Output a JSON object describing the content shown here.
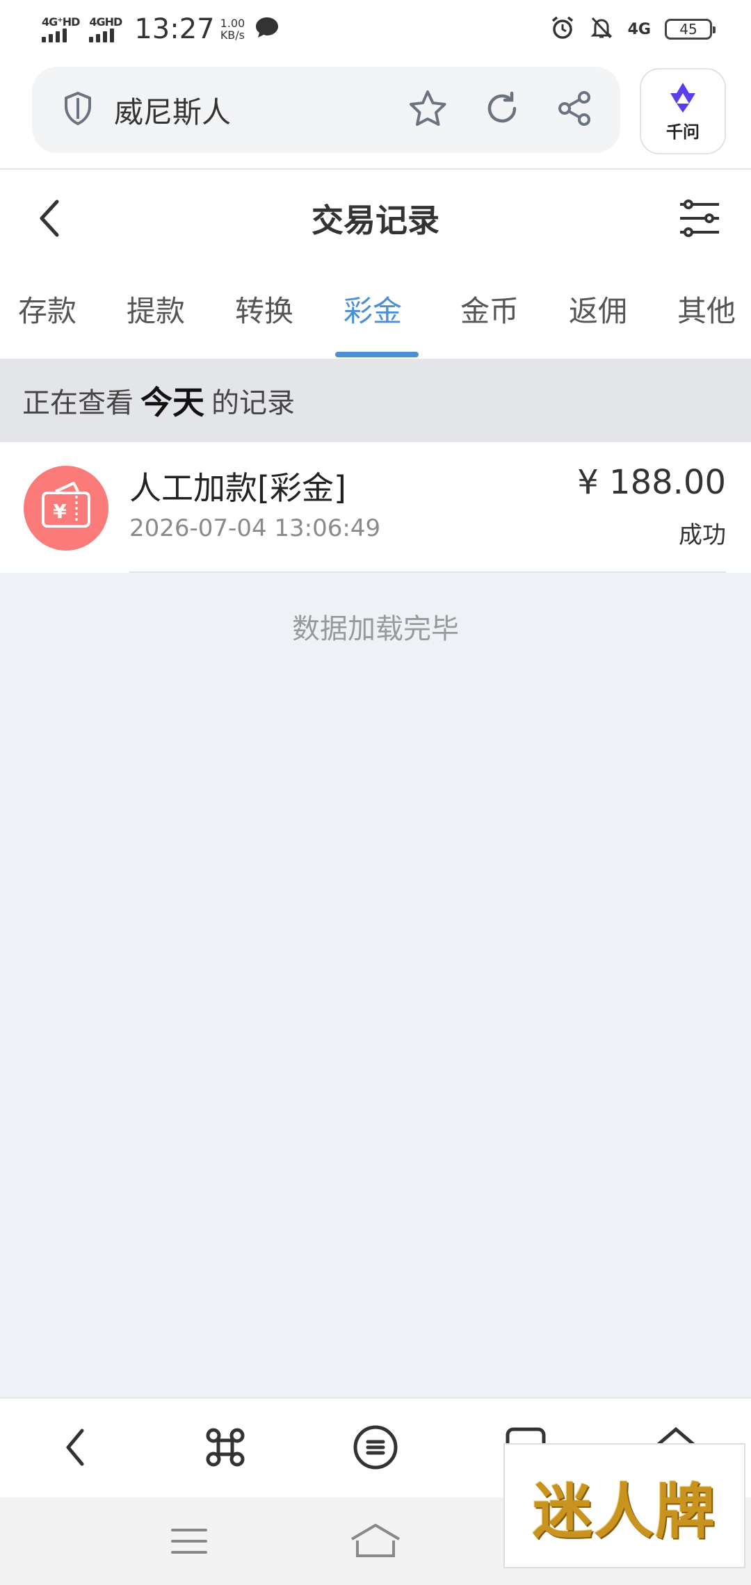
{
  "status_bar": {
    "sim1_label": "4G⁺HD",
    "sim2_label": "4GHD",
    "time": "13:27",
    "speed_value": "1.00",
    "speed_unit": "KB/s",
    "network_label": "4G",
    "battery": "45",
    "icons": [
      "chat-bubble-icon",
      "alarm-icon",
      "bell-off-icon"
    ]
  },
  "browser": {
    "url_text": "威尼斯人",
    "assistant_label": "千问",
    "icons": [
      "shield-icon",
      "star-icon",
      "refresh-icon",
      "share-icon",
      "qwen-logo-icon"
    ]
  },
  "header": {
    "title": "交易记录",
    "icons": [
      "back-icon",
      "filter-sliders-icon"
    ]
  },
  "tabs": [
    {
      "label": "存款"
    },
    {
      "label": "提款"
    },
    {
      "label": "转换"
    },
    {
      "label": "彩金",
      "active": true
    },
    {
      "label": "金币"
    },
    {
      "label": "返佣"
    },
    {
      "label": "其他"
    }
  ],
  "date_filter": {
    "prefix": "正在查看",
    "highlight": "今天",
    "suffix": "的记录"
  },
  "records": [
    {
      "title": "人工加款[彩金]",
      "time": "2026-07-04 13:06:49",
      "amount": "¥ 188.00",
      "status": "成功",
      "icon": "ticket-yuan-icon",
      "icon_color": "#fb7a7a"
    }
  ],
  "load_status": "数据加载完毕",
  "toolbar": {
    "icons": [
      "back-arrow-icon",
      "command-icon",
      "menu-icon",
      "tabs-icon",
      "home-icon"
    ]
  },
  "system_nav": {
    "icons": [
      "nav-menu-icon",
      "nav-home-icon"
    ]
  },
  "watermark": {
    "text": "迷人牌"
  },
  "colors": {
    "accent": "#4a90d9",
    "record_icon": "#fb7a7a",
    "background": "#eef2f6"
  }
}
